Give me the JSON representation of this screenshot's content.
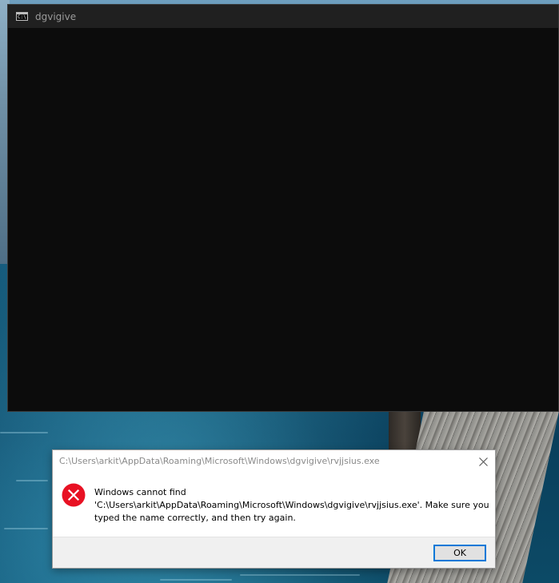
{
  "console_window": {
    "title": "dgvigive",
    "icon": "console-icon",
    "icon_text": "C:\\."
  },
  "error_dialog": {
    "title": "C:\\Users\\arkit\\AppData\\Roaming\\Microsoft\\Windows\\dgvigive\\rvjjsius.exe",
    "icon": "error-icon",
    "message_line1": "Windows cannot find",
    "message_line2": "'C:\\Users\\arkit\\AppData\\Roaming\\Microsoft\\Windows\\dgvigive\\rvjjsius.exe'. Make sure you",
    "message_line3": "typed the name correctly, and then try again.",
    "ok_label": "OK",
    "close_icon": "close-icon"
  },
  "colors": {
    "console_bg": "#0c0c0c",
    "console_titlebar": "#202020",
    "error_red": "#e81123",
    "dialog_footer": "#f0f0f0",
    "button_focus": "#0078d7"
  }
}
